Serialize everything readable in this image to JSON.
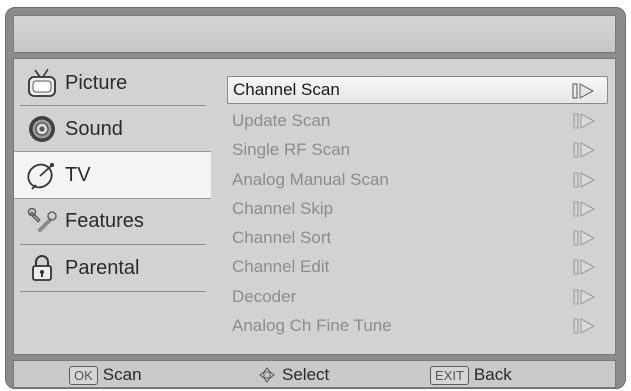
{
  "window_title": "",
  "sidebar": {
    "items": [
      {
        "label": "Picture",
        "icon": "tv-icon"
      },
      {
        "label": "Sound",
        "icon": "speaker-icon"
      },
      {
        "label": "TV",
        "icon": "satellite-dish-icon",
        "active": true
      },
      {
        "label": "Features",
        "icon": "wrench-icon"
      },
      {
        "label": "Parental",
        "icon": "lock-icon"
      }
    ]
  },
  "menu": {
    "selected_index": 0,
    "items": [
      {
        "label": "Channel Scan"
      },
      {
        "label": "Update Scan"
      },
      {
        "label": "Single RF Scan"
      },
      {
        "label": "Analog Manual Scan"
      },
      {
        "label": "Channel Skip"
      },
      {
        "label": "Channel Sort"
      },
      {
        "label": "Channel Edit"
      },
      {
        "label": "Decoder"
      },
      {
        "label": "Analog Ch Fine Tune"
      }
    ]
  },
  "footer": {
    "ok_key": "OK",
    "ok_label": "Scan",
    "select_label": "Select",
    "exit_key": "EXIT",
    "exit_label": "Back"
  },
  "colors": {
    "frame": "#8b8b8b",
    "panel": "#d2d2d2",
    "active_bg": "#f4f4f4",
    "disabled_text": "#8c8c8c"
  }
}
